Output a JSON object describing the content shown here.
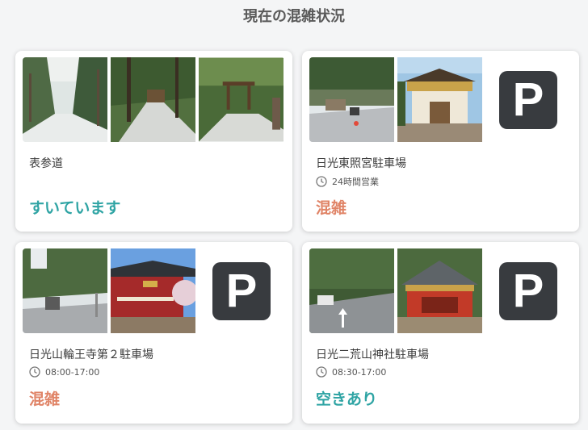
{
  "page": {
    "title": "現在の混雑状況"
  },
  "colors": {
    "empty": "#2fa4a4",
    "busy": "#e08467",
    "parking_tile": "#383b3f"
  },
  "locations": [
    {
      "name": "表参道",
      "hours": "",
      "status": "すいています",
      "status_level": "empty",
      "parking": false
    },
    {
      "name": "日光東照宮駐車場",
      "hours": "24時間営業",
      "status": "混雑",
      "status_level": "busy",
      "parking": true,
      "parking_symbol": "P"
    },
    {
      "name": "日光山輪王寺第２駐車場",
      "hours": "08:00-17:00",
      "status": "混雑",
      "status_level": "busy",
      "parking": true,
      "parking_symbol": "P"
    },
    {
      "name": "日光二荒山神社駐車場",
      "hours": "08:30-17:00",
      "status": "空きあり",
      "status_level": "empty",
      "parking": true,
      "parking_symbol": "P"
    }
  ]
}
